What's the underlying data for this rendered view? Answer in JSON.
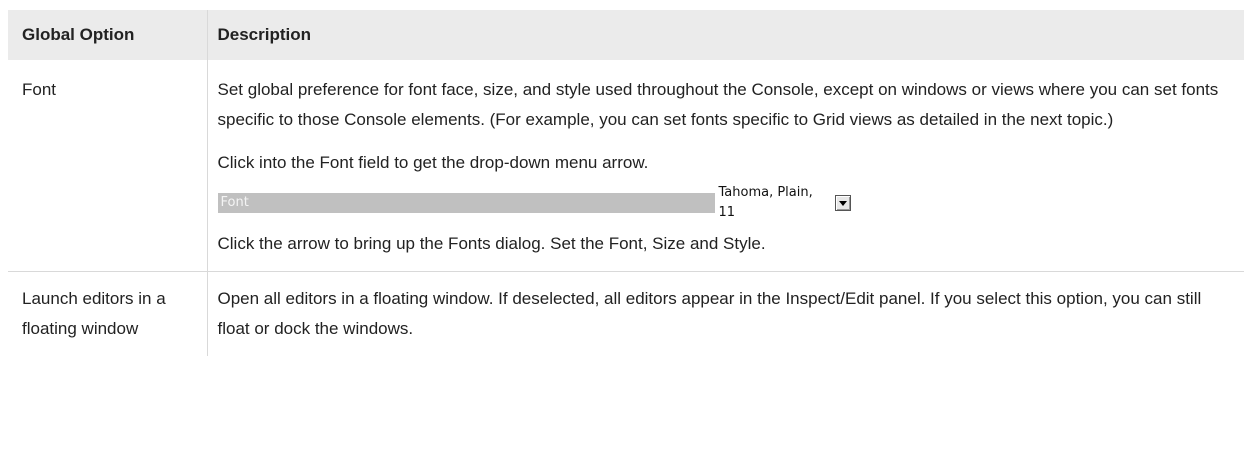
{
  "table": {
    "headers": {
      "option": "Global Option",
      "description": "Description"
    },
    "rows": [
      {
        "option": "Font",
        "paragraphs": [
          "Set global preference for font face, size, and style used throughout the Console, except on windows or views where you can set fonts specific to those Console elements. (For example, you can set fonts specific to Grid views as detailed in the next topic.)",
          "Click into the Font field to get the drop-down menu arrow.",
          "Click the arrow to bring up the Fonts dialog. Set the Font, Size and Style."
        ],
        "screenshot": {
          "field_label": "Font",
          "field_value": "Tahoma, Plain, 11",
          "button_icon": "dropdown-arrow-icon"
        }
      },
      {
        "option": "Launch editors in a floating window",
        "paragraphs": [
          "Open all editors in a floating window. If deselected, all editors appear in the Inspect/Edit panel. If you select this option, you can still float or dock the windows."
        ]
      }
    ]
  },
  "colors": {
    "header_bg": "#ebebeb",
    "border": "#d9d9d9",
    "text": "#222222",
    "screenshot_label_bg": "#c0c0c0"
  }
}
